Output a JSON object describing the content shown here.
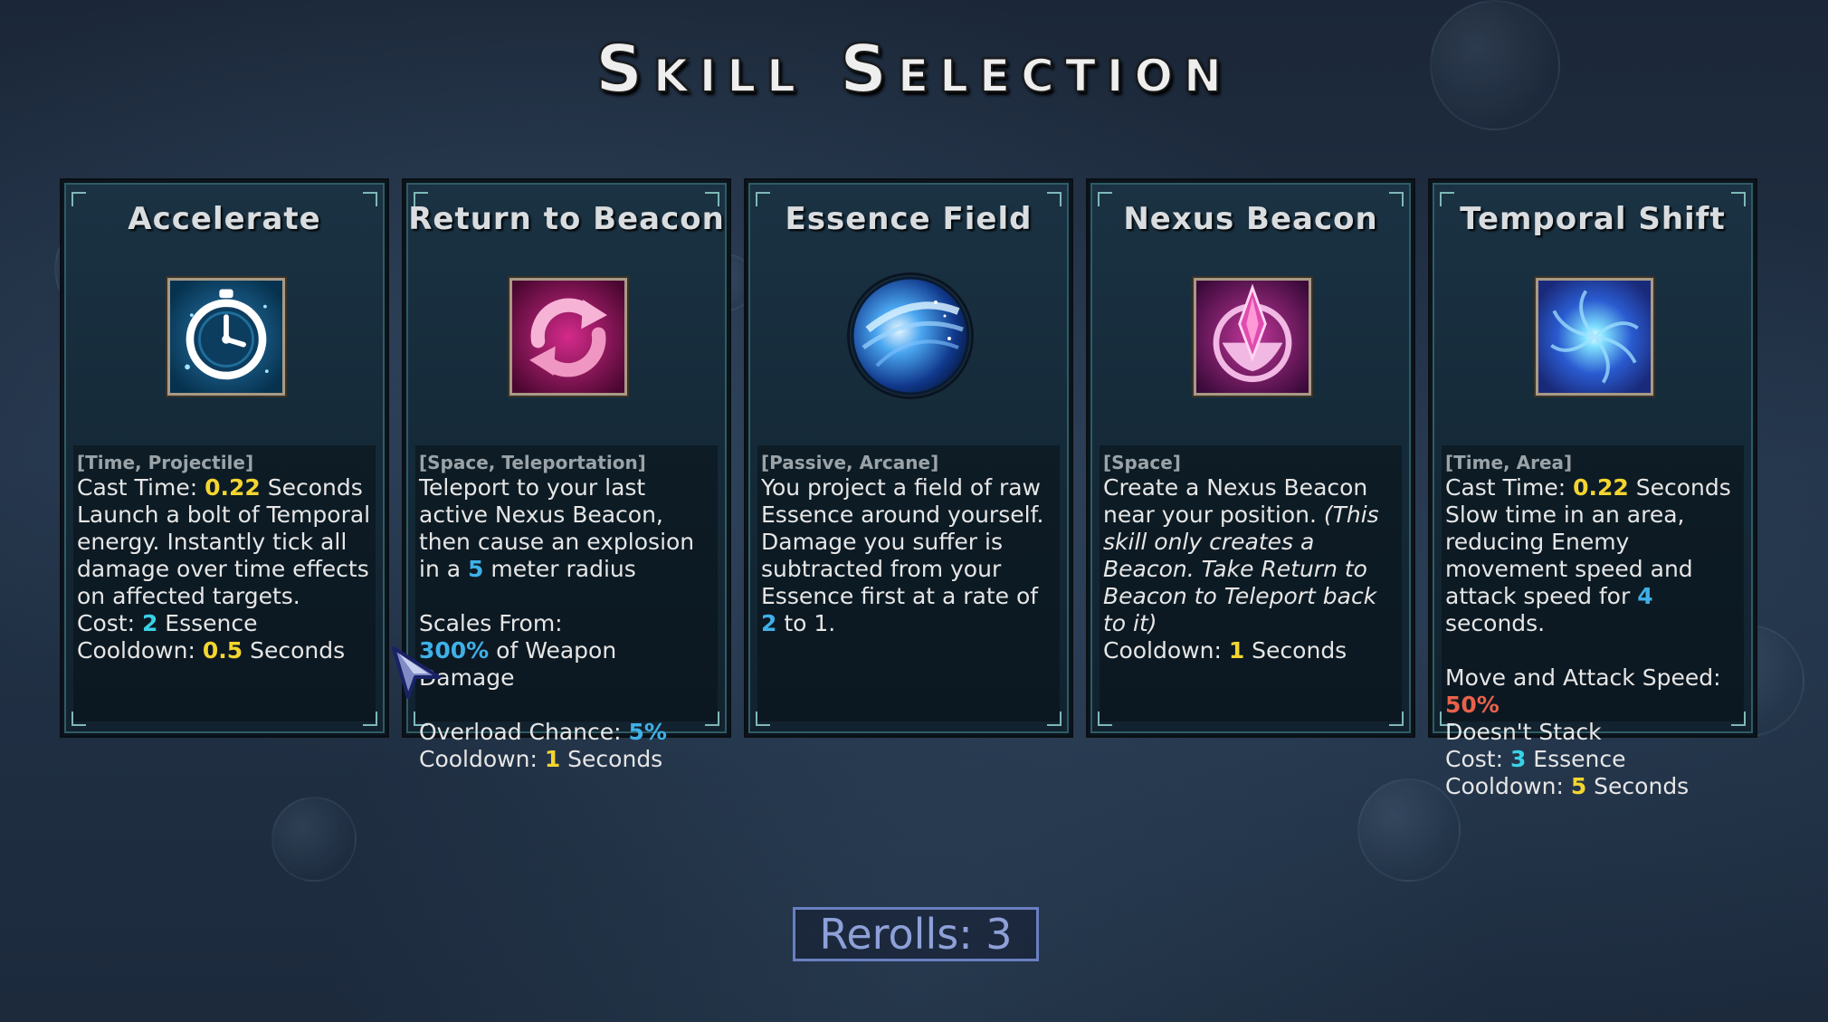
{
  "title": "Skill Selection",
  "cards": [
    {
      "name": "Accelerate",
      "icon": "stopwatch-icon",
      "tags": "[Time, Projectile]",
      "cast_label": "Cast Time: ",
      "cast_value": "0.22",
      "cast_unit": " Seconds",
      "body": "Launch a bolt of Temporal energy. Instantly tick all damage over time effects on affected targets.",
      "cost_label": "Cost: ",
      "cost_value": "2",
      "cost_unit": " Essence",
      "cooldown_label": "Cooldown: ",
      "cooldown_value": "0.5",
      "cooldown_unit": " Seconds"
    },
    {
      "name": "Return to Beacon",
      "icon": "return-arrows-icon",
      "tags": "[Space, Teleportation]",
      "body_a": "Teleport to your last active Nexus Beacon, then cause an explosion in a ",
      "radius_value": "5",
      "body_b": " meter radius",
      "scales_label": "Scales From:",
      "scales_value": "300%",
      "scales_unit": " of Weapon Damage",
      "overload_label": "Overload Chance: ",
      "overload_value": "5%",
      "cooldown_label": "Cooldown: ",
      "cooldown_value": "1",
      "cooldown_unit": " Seconds"
    },
    {
      "name": "Essence Field",
      "icon": "essence-orb-icon",
      "tags": "[Passive, Arcane]",
      "body_a": "You project a field of raw Essence around yourself. Damage you suffer is subtracted from your Essence first at a rate of ",
      "rate_value": "2",
      "body_b": " to 1."
    },
    {
      "name": "Nexus Beacon",
      "icon": "nexus-crystal-icon",
      "tags": "[Space]",
      "body_a": "Create a Nexus Beacon near your position. ",
      "body_italic": "(This skill only creates a Beacon. Take Return to Beacon to Teleport back to it)",
      "cooldown_label": "Cooldown: ",
      "cooldown_value": "1",
      "cooldown_unit": " Seconds"
    },
    {
      "name": "Temporal Shift",
      "icon": "vortex-icon",
      "tags": "[Time, Area]",
      "cast_label": "Cast Time: ",
      "cast_value": "0.22",
      "cast_unit": " Seconds",
      "body_a": "Slow time in an area, reducing Enemy movement speed and attack speed for ",
      "duration_value": "4",
      "body_b": " seconds.",
      "slow_label": "Move and Attack Speed: ",
      "slow_value": "50%",
      "stack_text": "Doesn't Stack",
      "cost_label": "Cost: ",
      "cost_value": "3",
      "cost_unit": " Essence",
      "cooldown_label": "Cooldown: ",
      "cooldown_value": "5",
      "cooldown_unit": " Seconds"
    }
  ],
  "rerolls_label": "Rerolls: 3",
  "colors": {
    "highlight_yellow": "#f4d530",
    "highlight_blue": "#3fb0e8",
    "highlight_cyan": "#38d2e8",
    "highlight_red": "#e8614a"
  }
}
